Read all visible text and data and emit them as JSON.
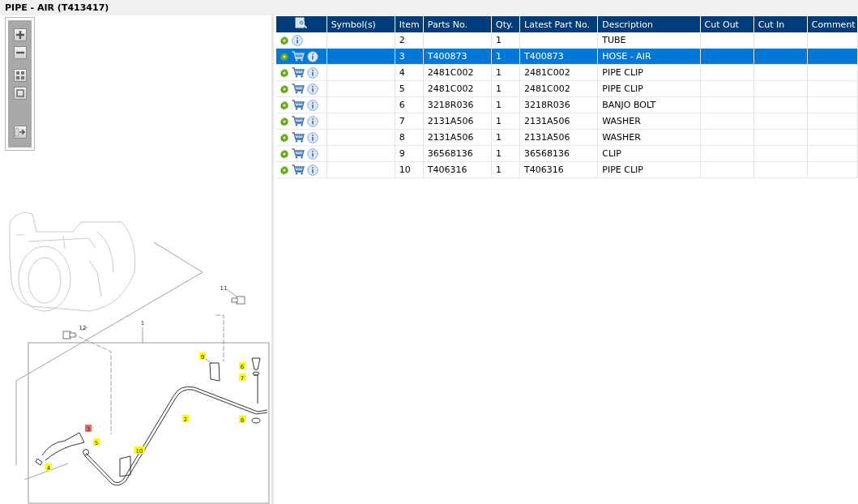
{
  "window": {
    "title": "PIPE - AIR (T413417)"
  },
  "diagram": {
    "callouts": [
      {
        "label": "1",
        "kind": "plain"
      },
      {
        "label": "2",
        "kind": "highlighted"
      },
      {
        "label": "3",
        "kind": "selected"
      },
      {
        "label": "4",
        "kind": "highlighted"
      },
      {
        "label": "5",
        "kind": "highlighted"
      },
      {
        "label": "6",
        "kind": "highlighted"
      },
      {
        "label": "7",
        "kind": "highlighted"
      },
      {
        "label": "8",
        "kind": "highlighted"
      },
      {
        "label": "9",
        "kind": "highlighted"
      },
      {
        "label": "10",
        "kind": "highlighted"
      },
      {
        "label": "11",
        "kind": "plain"
      },
      {
        "label": "12",
        "kind": "plain"
      }
    ]
  },
  "table": {
    "columns": [
      "Symbol(s)",
      "Item",
      "Parts No.",
      "Qty.",
      "Latest Part No.",
      "Description",
      "Cut Out",
      "Cut In",
      "Comment"
    ],
    "rows": [
      {
        "orderable": false,
        "selected": false,
        "cells": [
          "",
          "2",
          "",
          "1",
          "",
          "TUBE",
          "",
          "",
          ""
        ]
      },
      {
        "orderable": true,
        "selected": true,
        "cells": [
          "",
          "3",
          "T400873",
          "1",
          "T400873",
          "HOSE - AIR",
          "",
          "",
          ""
        ]
      },
      {
        "orderable": true,
        "selected": false,
        "cells": [
          "",
          "4",
          "2481C002",
          "1",
          "2481C002",
          "PIPE CLIP",
          "",
          "",
          ""
        ]
      },
      {
        "orderable": true,
        "selected": false,
        "cells": [
          "",
          "5",
          "2481C002",
          "1",
          "2481C002",
          "PIPE CLIP",
          "",
          "",
          ""
        ]
      },
      {
        "orderable": true,
        "selected": false,
        "cells": [
          "",
          "6",
          "3218R036",
          "1",
          "3218R036",
          "BANJO BOLT",
          "",
          "",
          ""
        ]
      },
      {
        "orderable": true,
        "selected": false,
        "cells": [
          "",
          "7",
          "2131A506",
          "1",
          "2131A506",
          "WASHER",
          "",
          "",
          ""
        ]
      },
      {
        "orderable": true,
        "selected": false,
        "cells": [
          "",
          "8",
          "2131A506",
          "1",
          "2131A506",
          "WASHER",
          "",
          "",
          ""
        ]
      },
      {
        "orderable": true,
        "selected": false,
        "cells": [
          "",
          "9",
          "36568136",
          "1",
          "36568136",
          "CLIP",
          "",
          "",
          ""
        ]
      },
      {
        "orderable": true,
        "selected": false,
        "cells": [
          "",
          "10",
          "T406316",
          "1",
          "T406316",
          "PIPE CLIP",
          "",
          "",
          ""
        ]
      }
    ]
  }
}
